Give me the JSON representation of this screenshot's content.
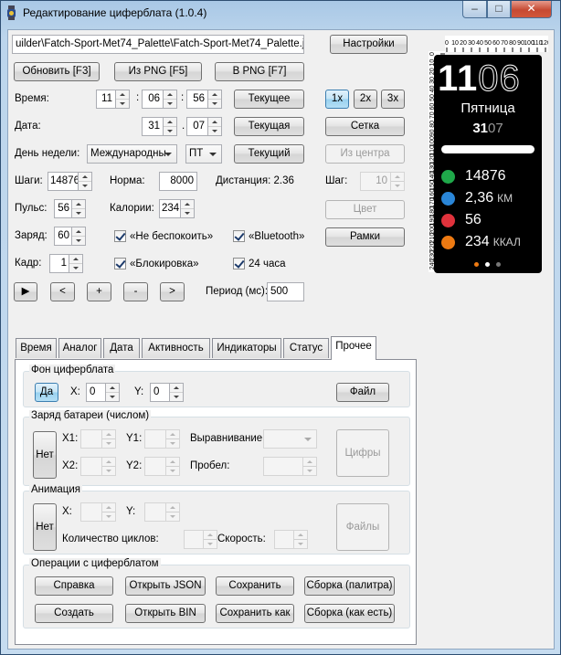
{
  "window": {
    "title": "Редактирование циферблата (1.0.4)",
    "controls": {
      "minimize": "–",
      "maximize": "□",
      "close": "✕"
    }
  },
  "file_path": "uilder\\Fatch-Sport-Met74_Palette\\Fatch-Sport-Met74_Palette.json",
  "buttons": {
    "settings": "Настройки",
    "refresh": "Обновить [F3]",
    "from_png": "Из PNG [F5]",
    "to_png": "В PNG [F7]",
    "current_time": "Текущее",
    "current_date": "Текущая",
    "current_weekday": "Текущий",
    "zoom1": "1x",
    "zoom2": "2x",
    "zoom3": "3x",
    "grid": "Сетка",
    "from_center": "Из центра",
    "color": "Цвет",
    "frames": "Рамки",
    "play": "▶",
    "prev": "<",
    "plus": "+",
    "minus": "-",
    "next": ">"
  },
  "fields": {
    "time_label": "Время:",
    "hours": "11",
    "minutes": "06",
    "seconds": "56",
    "colon": ":",
    "date_label": "Дата:",
    "day": "31",
    "month": "07",
    "dot": ".",
    "weekday_label": "День недели:",
    "weekday_locale": "Международны",
    "weekday_value": "ПТ",
    "steps_label": "Шаги:",
    "steps": "14876",
    "norm_label": "Норма:",
    "norm": "8000",
    "distance": "Дистанция: 2.36",
    "step_label": "Шаг:",
    "step_value": "10",
    "pulse_label": "Пульс:",
    "pulse": "56",
    "calories_label": "Калории:",
    "calories": "234",
    "charge_label": "Заряд:",
    "charge": "60",
    "frame_label": "Кадр:",
    "frame": "1",
    "period_label": "Период (мс):",
    "period": "500"
  },
  "checkboxes": {
    "dnd": {
      "label": "«Не беспокоить»",
      "checked": true
    },
    "bluetooth": {
      "label": "«Bluetooth»",
      "checked": true
    },
    "lock": {
      "label": "«Блокировка»",
      "checked": true
    },
    "h24": {
      "label": "24 часа",
      "checked": true
    }
  },
  "tabs": [
    "Время",
    "Аналог",
    "Дата",
    "Активность",
    "Индикаторы",
    "Статус",
    "Прочее"
  ],
  "active_tab": "Прочее",
  "panel": {
    "background_group": {
      "title": "Фон циферблата",
      "yes": "Да",
      "x_label": "X:",
      "x": "0",
      "y_label": "Y:",
      "y": "0",
      "file": "Файл"
    },
    "battery_group": {
      "title": "Заряд батареи (числом)",
      "no": "Нет",
      "x1": "X1:",
      "y1": "Y1:",
      "x2": "X2:",
      "y2": "Y2:",
      "align": "Выравнивание:",
      "gap": "Пробел:",
      "digits": "Цифры"
    },
    "animation_group": {
      "title": "Анимация",
      "no": "Нет",
      "x": "X:",
      "y": "Y:",
      "cycles": "Количество циклов:",
      "speed": "Скорость:",
      "files": "Файлы"
    },
    "operations_group": {
      "title": "Операции с циферблатом",
      "help": "Справка",
      "open_json": "Открыть JSON",
      "save": "Сохранить",
      "build_palette": "Сборка (палитра)",
      "create": "Создать",
      "open_bin": "Открыть BIN",
      "save_as": "Сохранить как",
      "build_asis": "Сборка (как есть)"
    }
  },
  "ruler": {
    "h_labels": [
      "0",
      "10",
      "20",
      "30",
      "40",
      "50",
      "60",
      "70",
      "80",
      "90",
      "100",
      "110",
      "120"
    ],
    "v_labels": [
      "0",
      "10",
      "20",
      "30",
      "40",
      "50",
      "60",
      "70",
      "80",
      "90",
      "100",
      "110",
      "120",
      "130",
      "140",
      "150",
      "160",
      "170",
      "180",
      "190",
      "200",
      "210",
      "220",
      "230",
      "240"
    ]
  },
  "watch": {
    "hours": "11",
    "minutes": "06",
    "weekday": "Пятница",
    "day": "31",
    "month": "07",
    "steps": "14876",
    "distance": "2,36",
    "distance_unit": "КМ",
    "pulse": "56",
    "calories": "234",
    "calories_unit": "ККАЛ",
    "colors": {
      "steps": "#1fa84a",
      "distance": "#2a86d8",
      "pulse": "#e0323c",
      "calories": "#ee7a12",
      "dot_active": "#ee7a12"
    }
  }
}
